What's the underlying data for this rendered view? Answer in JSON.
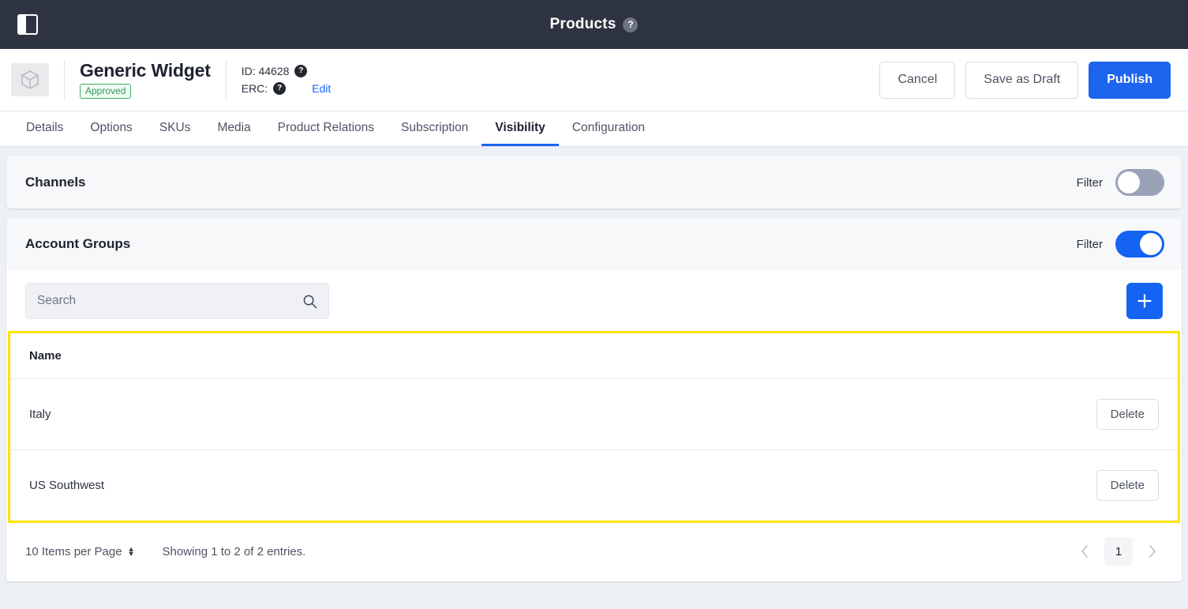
{
  "topbar": {
    "title": "Products",
    "help_icon": "help-circle-icon",
    "help_glyph": "?",
    "sidebar_toggle_icon": "sidebar-toggle-icon"
  },
  "product_header": {
    "thumb_icon": "package-box-icon",
    "title": "Generic Widget",
    "status_badge": "Approved",
    "id_label": "ID: 44628",
    "id_help_glyph": "?",
    "erc_label": "ERC:",
    "erc_help_glyph": "?",
    "edit_link": "Edit",
    "buttons": {
      "cancel": "Cancel",
      "save_draft": "Save as Draft",
      "publish": "Publish"
    }
  },
  "tabs": [
    {
      "label": "Details",
      "active": false
    },
    {
      "label": "Options",
      "active": false
    },
    {
      "label": "SKUs",
      "active": false
    },
    {
      "label": "Media",
      "active": false
    },
    {
      "label": "Product Relations",
      "active": false
    },
    {
      "label": "Subscription",
      "active": false
    },
    {
      "label": "Visibility",
      "active": true
    },
    {
      "label": "Configuration",
      "active": false
    }
  ],
  "channels_card": {
    "title": "Channels",
    "filter_label": "Filter",
    "filter_on": false
  },
  "account_groups_card": {
    "title": "Account Groups",
    "filter_label": "Filter",
    "filter_on": true,
    "search_placeholder": "Search",
    "search_value": "",
    "search_icon": "search-icon",
    "add_icon": "plus-icon",
    "table": {
      "columns": [
        "Name"
      ],
      "action_label": "Delete",
      "rows": [
        {
          "name": "Italy",
          "action": "Delete"
        },
        {
          "name": "US Southwest",
          "action": "Delete"
        }
      ]
    },
    "footer": {
      "per_page": "10 Items per Page",
      "showing": "Showing 1 to 2 of 2 entries.",
      "prev_icon": "chevron-left-icon",
      "next_icon": "chevron-right-icon",
      "current_page": "1"
    }
  },
  "colors": {
    "accent": "#1463f3",
    "topbar": "#2e3342",
    "page_bg": "#edf0f4",
    "approved_green": "#2f9c55",
    "highlight_yellow": "#ffe300"
  }
}
